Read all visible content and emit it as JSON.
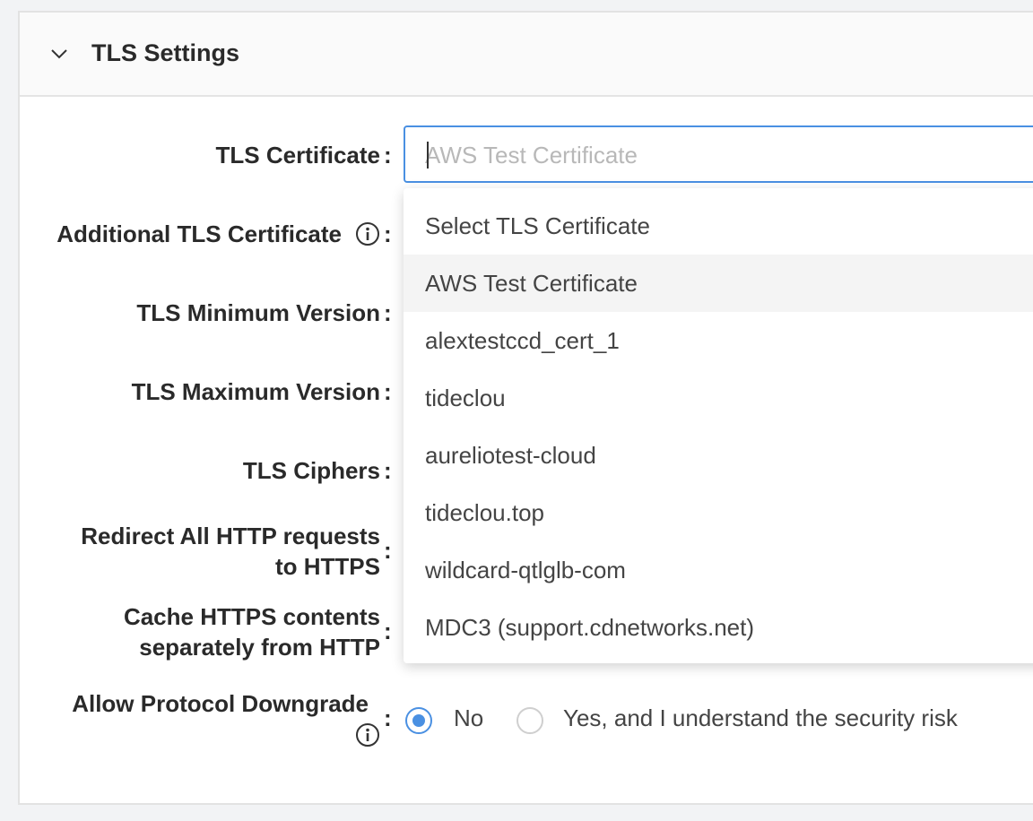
{
  "section": {
    "title": "TLS Settings",
    "collapse_icon": "chevron-down-icon"
  },
  "fields": {
    "tls_certificate": {
      "label": "TLS Certificate",
      "placeholder": "AWS Test Certificate"
    },
    "additional_tls_certificate": {
      "label": "Additional TLS Certificate",
      "info_icon": "info-icon"
    },
    "tls_minimum_version": {
      "label": "TLS Minimum Version"
    },
    "tls_maximum_version": {
      "label": "TLS Maximum Version"
    },
    "tls_ciphers": {
      "label": "TLS Ciphers"
    },
    "redirect_http": {
      "label": "Redirect All HTTP requests to HTTPS"
    },
    "cache_https": {
      "label": "Cache HTTPS contents separately from HTTP"
    },
    "allow_protocol_downgrade": {
      "label": "Allow Protocol Downgrade",
      "info_icon": "info-icon",
      "options": [
        {
          "label": "No",
          "selected": true
        },
        {
          "label": "Yes, and I understand the security risk",
          "selected": false
        }
      ]
    }
  },
  "colon": ":",
  "dropdown": {
    "options": [
      {
        "label": "Select TLS Certificate",
        "highlighted": false
      },
      {
        "label": "AWS Test Certificate",
        "highlighted": true
      },
      {
        "label": "alextestccd_cert_1",
        "highlighted": false
      },
      {
        "label": "tideclou",
        "highlighted": false
      },
      {
        "label": "aureliotest-cloud",
        "highlighted": false
      },
      {
        "label": "tideclou.top",
        "highlighted": false
      },
      {
        "label": "wildcard-qtlglb-com",
        "highlighted": false
      },
      {
        "label": "MDC3 (support.cdnetworks.net)",
        "highlighted": false
      }
    ]
  },
  "colors": {
    "accent": "#4a90e2",
    "highlight_row": "#f4f4f4",
    "placeholder": "#b8b8b8"
  }
}
